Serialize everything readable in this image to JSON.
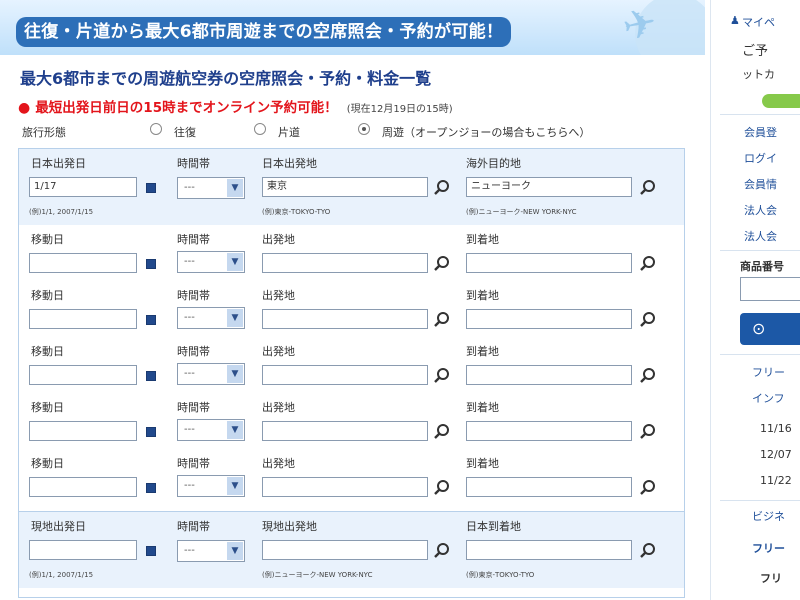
{
  "banner": {
    "title": "往復・片道から最大6都市周遊までの空席照会・予約が可能！"
  },
  "heading": "最大6都市までの周遊航空券の空席照会・予約・料金一覧",
  "notice": {
    "dot": "●",
    "text": "最短出発日前日の15時までオンライン予約可能！",
    "sub": "(現在12月19日の15時)"
  },
  "trip_type": {
    "label": "旅行形態",
    "options": [
      "往復",
      "片道",
      "周遊（オープンジョーの場合もこちらへ）"
    ],
    "selected": "周遊（オープンジョーの場合もこちらへ）"
  },
  "rows": [
    {
      "date_label": "日本出発日",
      "time_label": "時間帯",
      "from_label": "日本出発地",
      "to_label": "海外目的地",
      "date_value": "1/17",
      "time_value": "---",
      "from_value": "東京",
      "to_value": "ニューヨーク",
      "date_hint": "(例)1/1, 2007/1/15",
      "from_hint": "(例)東京-TOKYO-TYO",
      "to_hint": "(例)ニューヨーク-NEW YORK-NYC"
    },
    {
      "date_label": "移動日",
      "time_label": "時間帯",
      "from_label": "出発地",
      "to_label": "到着地",
      "time_value": "---"
    },
    {
      "date_label": "移動日",
      "time_label": "時間帯",
      "from_label": "出発地",
      "to_label": "到着地",
      "time_value": "---"
    },
    {
      "date_label": "移動日",
      "time_label": "時間帯",
      "from_label": "出発地",
      "to_label": "到着地",
      "time_value": "---"
    },
    {
      "date_label": "移動日",
      "time_label": "時間帯",
      "from_label": "出発地",
      "to_label": "到着地",
      "time_value": "---"
    },
    {
      "date_label": "移動日",
      "time_label": "時間帯",
      "from_label": "出発地",
      "to_label": "到着地",
      "time_value": "---"
    },
    {
      "date_label": "現地出発日",
      "time_label": "時間帯",
      "from_label": "現地出発地",
      "to_label": "日本到着地",
      "time_value": "---",
      "date_hint": "(例)1/1, 2007/1/15",
      "from_hint": "(例)ニューヨーク-NEW YORK-NYC",
      "to_hint": "(例)東京-TOKYO-TYO"
    }
  ],
  "sidebar": {
    "mypage": "マイペ",
    "greeting": "ご予",
    "card": "ットカ",
    "links": [
      "会員登",
      "ログイ",
      "会員情",
      "法人会",
      "法人会"
    ],
    "product_label": "商品番号",
    "free_label": "フリー",
    "info_label": "インフ",
    "dates": [
      "11/16",
      "12/07",
      "11/22"
    ],
    "business_label": "ビジネ",
    "free2_label": "フリー",
    "bottom_label": "フリ"
  }
}
